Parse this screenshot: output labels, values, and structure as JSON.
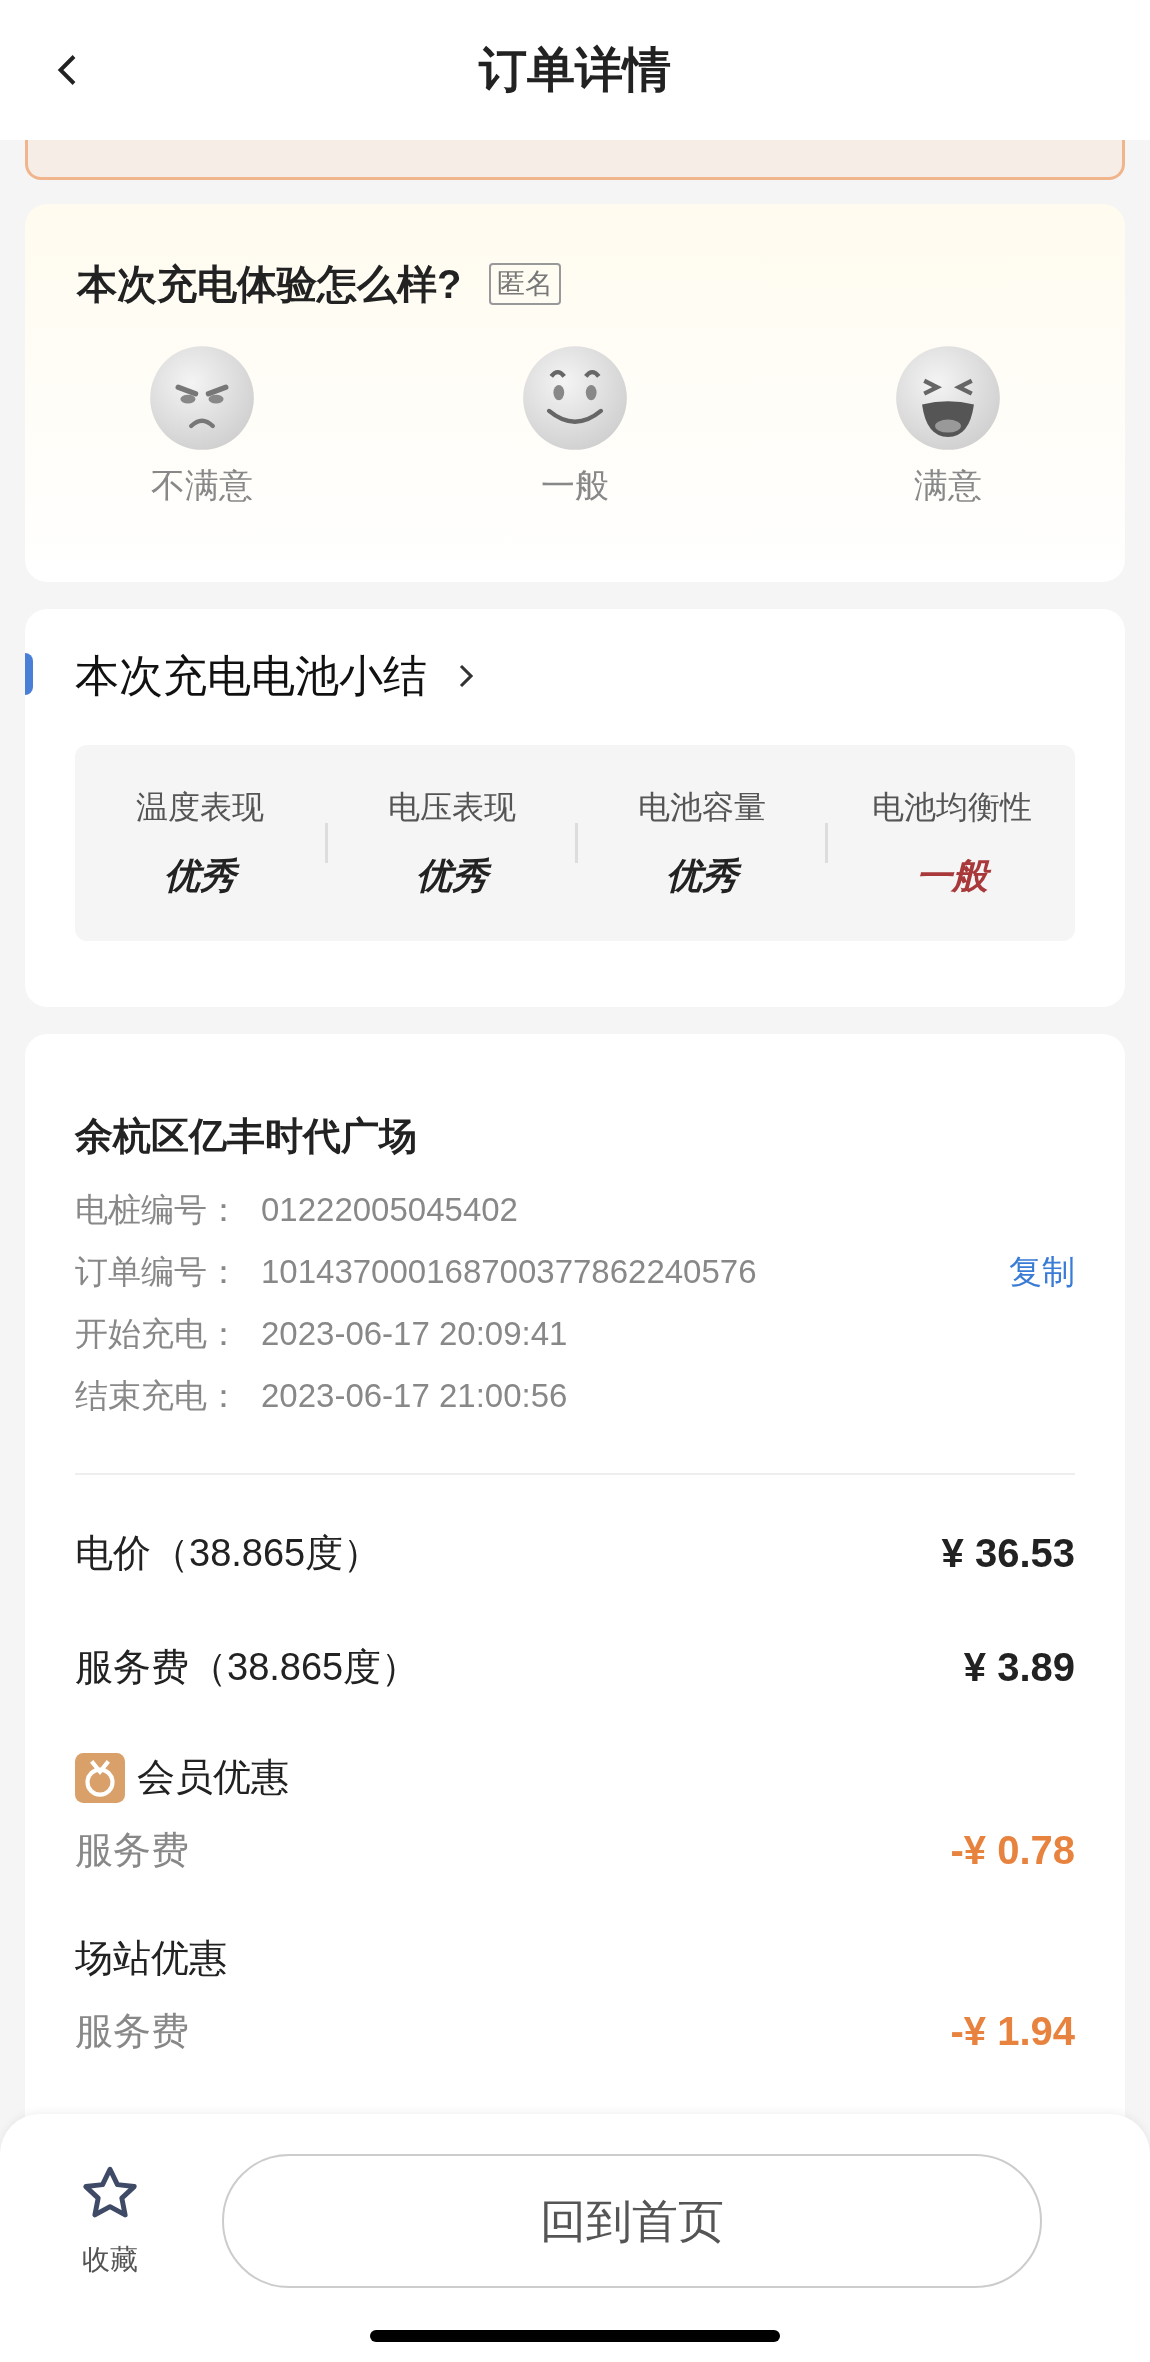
{
  "header": {
    "title": "订单详情"
  },
  "rating": {
    "title": "本次充电体验怎么样?",
    "badge": "匿名",
    "options": [
      {
        "kind": "angry",
        "label": "不满意"
      },
      {
        "kind": "smile",
        "label": "一般"
      },
      {
        "kind": "laugh",
        "label": "满意"
      }
    ]
  },
  "battery": {
    "title": "本次充电电池小结",
    "metrics": [
      {
        "label": "温度表现",
        "value": "优秀",
        "color": "#222222"
      },
      {
        "label": "电压表现",
        "value": "优秀",
        "color": "#222222"
      },
      {
        "label": "电池容量",
        "value": "优秀",
        "color": "#222222"
      },
      {
        "label": "电池均衡性",
        "value": "一般",
        "color": "#a8383a"
      }
    ]
  },
  "order": {
    "station": "余杭区亿丰时代广场",
    "details": [
      {
        "label": "电桩编号：",
        "value": "01222005045402"
      },
      {
        "label": "订单编号：",
        "value": "101437000168700377862240576",
        "action": "复制"
      },
      {
        "label": "开始充电：",
        "value": "2023-06-17 20:09:41"
      },
      {
        "label": "结束充电：",
        "value": "2023-06-17 21:00:56"
      }
    ],
    "fees": [
      {
        "kind": "charge",
        "label": "电价（38.865度）",
        "amount": "¥ 36.53"
      },
      {
        "kind": "charge",
        "label": "服务费（38.865度）",
        "amount": "¥ 3.89"
      },
      {
        "kind": "discount",
        "icon": true,
        "label": "会员优惠",
        "sublabel": "服务费",
        "amount": "-¥ 0.78"
      },
      {
        "kind": "discount",
        "icon": false,
        "label": "场站优惠",
        "sublabel": "服务费",
        "amount": "-¥ 1.94"
      }
    ]
  },
  "bottom_bar": {
    "favorite": "收藏",
    "home_button": "回到首页"
  }
}
